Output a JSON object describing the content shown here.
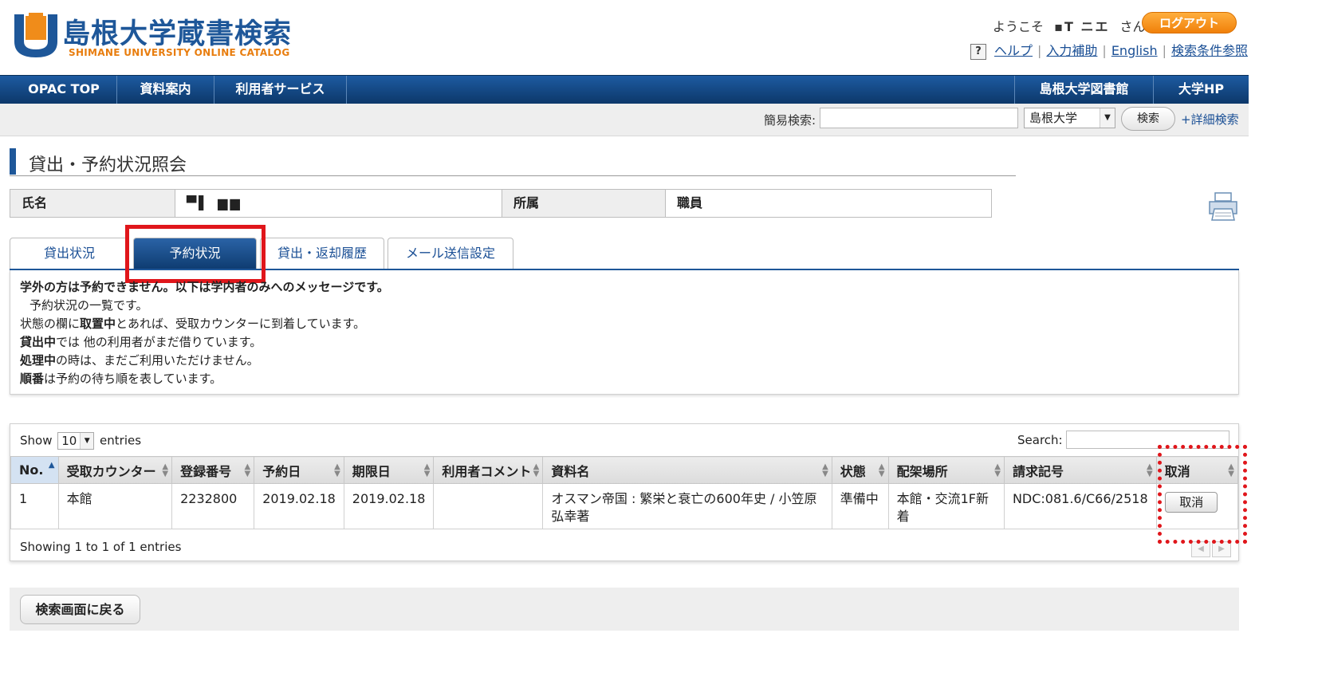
{
  "header": {
    "logo_title": "島根大学蔵書検索",
    "logo_subtitle": "SHIMANE UNIVERSITY ONLINE CATALOG",
    "welcome_prefix": "ようこそ",
    "user_name": "▪T ニエ",
    "welcome_suffix": "さん",
    "logout_label": "ログアウト",
    "help_icon_char": "?",
    "links": {
      "help": "ヘルプ",
      "input_assist": "入力補助",
      "english": "English",
      "search_terms": "検索条件参照"
    }
  },
  "nav": {
    "opac_top": "OPAC TOP",
    "guide": "資料案内",
    "user_services": "利用者サービス",
    "library": "島根大学図書館",
    "university_hp": "大学HP"
  },
  "quick_search": {
    "label": "簡易検索:",
    "value": "",
    "scope_selected": "島根大学",
    "button_label": "検索",
    "advanced_link": "+詳細検索"
  },
  "page": {
    "title": "貸出・予約状況照会"
  },
  "user_info": {
    "name_label": "氏名",
    "name_value": "▀▌ ▆▆",
    "affiliation_label": "所属",
    "affiliation_value": "職員"
  },
  "tabs": [
    {
      "label": "貸出状況"
    },
    {
      "label": "予約状況"
    },
    {
      "label": "貸出・返却履歴"
    },
    {
      "label": "メール送信設定"
    }
  ],
  "message": {
    "line1": "学外の方は予約できません。以下は学内者のみへのメッセージです。",
    "line2": "予約状況の一覧です。",
    "line3_pre": "状態の欄に",
    "line3_bold": "取置中",
    "line3_post": "とあれば、受取カウンターに到着しています。",
    "line4_bold": "貸出中",
    "line4_post": "では 他の利用者がまだ借りています。",
    "line5_bold": "処理中",
    "line5_post": "の時は、まだご利用いただけません。",
    "line6_bold": "順番",
    "line6_post": "は予約の待ち順を表しています。"
  },
  "table": {
    "show_label": "Show",
    "entries_label": "entries",
    "page_size": "10",
    "search_label": "Search:",
    "search_value": "",
    "columns": [
      "No.",
      "受取カウンター",
      "登録番号",
      "予約日",
      "期限日",
      "利用者コメント",
      "資料名",
      "状態",
      "配架場所",
      "請求記号",
      "取消"
    ],
    "rows": [
      {
        "no": "1",
        "counter": "本館",
        "reg_no": "2232800",
        "reserve_date": "2019.02.18",
        "due_date": "2019.02.18",
        "comment": "",
        "title": "オスマン帝国 : 繁栄と衰亡の600年史 / 小笠原弘幸著",
        "status": "準備中",
        "location": "本館・交流1F新着",
        "call_no": "NDC:081.6/C66/2518",
        "cancel_label": "取消"
      }
    ],
    "info": "Showing 1 to 1 of 1 entries"
  },
  "back_button": "検索画面に戻る",
  "colors": {
    "brand_blue": "#1e5799",
    "accent_orange": "#f0800a",
    "highlight_red": "#e0161b"
  }
}
